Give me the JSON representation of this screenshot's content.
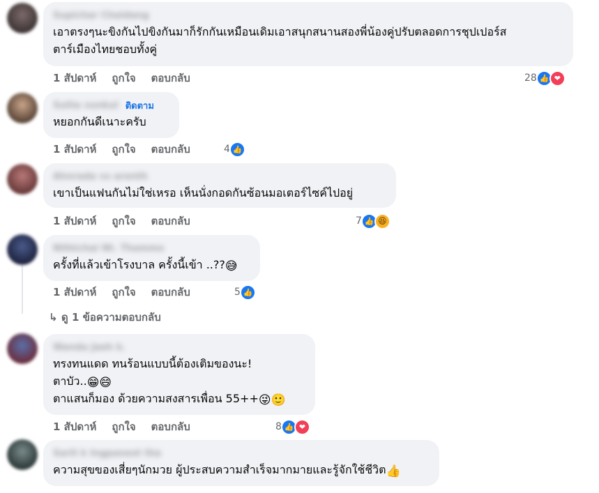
{
  "labels": {
    "like": "ถูกใจ",
    "reply": "ตอบกลับ"
  },
  "colors": {
    "bubble": "#f0f2f5",
    "meta_text": "#65676b",
    "link_blue": "#1b74e4",
    "like_blue": "#1877f2",
    "love_red": "#f33e58",
    "haha_yellow": "#f7b125"
  },
  "comments": [
    {
      "author": "Supichar Chaidang",
      "lines": [
        "เอาตรงๆนะขิงกันไปขิงกันมาก็รักกันเหมือนเดิมเอาสนุกสนานสองพี่น้องคู่ปรับตลอดการชุปเปอร์ส",
        "ตาร์เมืองไทยชอบทั้งคู่"
      ],
      "time": "1 สัปดาห์",
      "reaction_count": "28",
      "reactions": [
        "like-icon",
        "love-icon"
      ]
    },
    {
      "author": "Sutta vunkul",
      "follow": "ติดตาม",
      "lines": [
        "หยอกกันดีเนาะครับ"
      ],
      "time": "1 สัปดาห์",
      "reaction_count": "4",
      "reactions": [
        "like-icon"
      ]
    },
    {
      "author": "Ahnrada vs arenth",
      "lines": [
        "เขาเป็นแฟนกันไม่ใช่เหรอ เห็นนั่งกอดกันซ้อนมอเตอร์ไซค์ไปอยู่"
      ],
      "time": "1 สัปดาห์",
      "reaction_count": "7",
      "reactions": [
        "like-icon",
        "haha-icon"
      ]
    },
    {
      "author": "Nithichai Nt. Thammo",
      "lines": [
        "ครั้งที่แล้วเข้าโรงบาล ครั้งนี้เข้า ..??"
      ],
      "line_emoji": [
        "sweat-smile-emoji"
      ],
      "time": "1 สัปดาห์",
      "reaction_count": "5",
      "reactions": [
        "like-icon"
      ],
      "view_replies": "ดู 1 ข้อความตอบกลับ"
    },
    {
      "author": "Wanda Jaeh k.",
      "lines": [
        "ทรงทนแดด ทนร้อนแบบนี้ต้องเติมของนะ!",
        "ตาบัว..",
        "ตาแสนก็มอง ด้วยความสงสารเพื่อน 55++"
      ],
      "line_emoji": [
        "",
        "grin-emoji grin-emoji",
        "tongue-emoji zany-emoji"
      ],
      "time": "1 สัปดาห์",
      "reaction_count": "8",
      "reactions": [
        "like-icon",
        "love-icon"
      ]
    },
    {
      "author": "Sarit k Ingpanest tha",
      "lines": [
        "ความสุขของเสี่ยๆนักมวย ผู้ประสบความสำเร็จมากมายและรู้จักใช้ชีวิต"
      ],
      "line_emoji": [
        "thumbs-up-emoji"
      ]
    }
  ]
}
